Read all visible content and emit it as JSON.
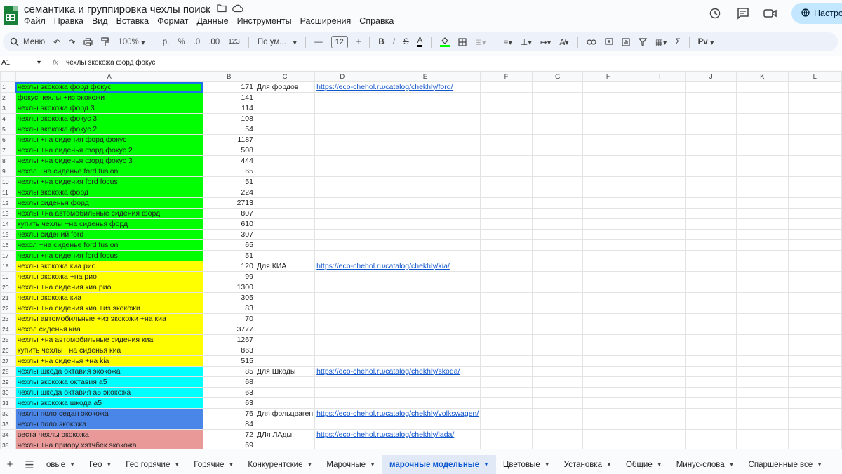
{
  "doc": {
    "title": "семантика и группировка чехлы поиск",
    "menu": [
      "Файл",
      "Правка",
      "Вид",
      "Вставка",
      "Формат",
      "Данные",
      "Инструменты",
      "Расширения",
      "Справка"
    ],
    "share_label": "Настро"
  },
  "toolbar": {
    "search_menu": "Меню",
    "zoom": "100%",
    "currency": "р.",
    "percent": "%",
    "dec_dec": ".0",
    "dec_inc": ".00",
    "number_format": "123",
    "font": "По ум...",
    "font_size": "12",
    "bold": "B",
    "italic": "I",
    "strike": "S",
    "text_color": "A",
    "sum": "Σ",
    "input_tool": "Pv"
  },
  "formula_bar": {
    "cell_ref": "A1",
    "fx": "fx",
    "content": "чехлы экокожа форд фокус"
  },
  "grid": {
    "columns": [
      "A",
      "B",
      "C",
      "D",
      "E",
      "F",
      "G",
      "H",
      "I",
      "J",
      "K",
      "L"
    ],
    "colors": {
      "green": "#00ff00",
      "yellow": "#ffff00",
      "cyan": "#00ffff",
      "blue": "#4a86e8",
      "pink": "#ea9999"
    },
    "rows": [
      {
        "n": "1",
        "a": "чехлы экокожа форд фокус",
        "b": "171",
        "c": "Для фордов",
        "d": "https://eco-chehol.ru/catalog/chekhly/ford/",
        "color": "green"
      },
      {
        "n": "2",
        "a": "фокус чехлы +из экокожи",
        "b": "141",
        "c": "",
        "d": "",
        "color": "green"
      },
      {
        "n": "3",
        "a": "чехлы экокожа форд 3",
        "b": "114",
        "c": "",
        "d": "",
        "color": "green"
      },
      {
        "n": "4",
        "a": "чехлы экокожа фокус 3",
        "b": "108",
        "c": "",
        "d": "",
        "color": "green"
      },
      {
        "n": "5",
        "a": "чехлы экокожа фокус 2",
        "b": "54",
        "c": "",
        "d": "",
        "color": "green"
      },
      {
        "n": "6",
        "a": "чехлы +на сидения форд фокус",
        "b": "1187",
        "c": "",
        "d": "",
        "color": "green"
      },
      {
        "n": "7",
        "a": "чехлы +на сиденья форд фокус 2",
        "b": "508",
        "c": "",
        "d": "",
        "color": "green"
      },
      {
        "n": "8",
        "a": "чехлы +на сиденья форд фокус 3",
        "b": "444",
        "c": "",
        "d": "",
        "color": "green"
      },
      {
        "n": "9",
        "a": "чехол +на сиденье ford fusion",
        "b": "65",
        "c": "",
        "d": "",
        "color": "green"
      },
      {
        "n": "10",
        "a": "чехлы +на сидения ford focus",
        "b": "51",
        "c": "",
        "d": "",
        "color": "green"
      },
      {
        "n": "11",
        "a": "чехлы экокожа форд",
        "b": "224",
        "c": "",
        "d": "",
        "color": "green"
      },
      {
        "n": "12",
        "a": "чехлы сиденья форд",
        "b": "2713",
        "c": "",
        "d": "",
        "color": "green"
      },
      {
        "n": "13",
        "a": "чехлы +на автомобильные сидения форд",
        "b": "807",
        "c": "",
        "d": "",
        "color": "green"
      },
      {
        "n": "14",
        "a": "купить чехлы +на сиденья форд",
        "b": "610",
        "c": "",
        "d": "",
        "color": "green"
      },
      {
        "n": "15",
        "a": "чехлы сидений ford",
        "b": "307",
        "c": "",
        "d": "",
        "color": "green"
      },
      {
        "n": "16",
        "a": "чехол +на сиденье ford fusion",
        "b": "65",
        "c": "",
        "d": "",
        "color": "green"
      },
      {
        "n": "17",
        "a": "чехлы +на сидения ford focus",
        "b": "51",
        "c": "",
        "d": "",
        "color": "green"
      },
      {
        "n": "18",
        "a": "чехлы экокожа киа рио",
        "b": "120",
        "c": "Для КИА",
        "d": "https://eco-chehol.ru/catalog/chekhly/kia/",
        "color": "yellow"
      },
      {
        "n": "19",
        "a": "чехлы экокожа +на рио",
        "b": "99",
        "c": "",
        "d": "",
        "color": "yellow"
      },
      {
        "n": "20",
        "a": "чехлы +на сидения киа рио",
        "b": "1300",
        "c": "",
        "d": "",
        "color": "yellow"
      },
      {
        "n": "21",
        "a": "чехлы экокожа киа",
        "b": "305",
        "c": "",
        "d": "",
        "color": "yellow"
      },
      {
        "n": "22",
        "a": "чехлы +на сидения киа +из экокожи",
        "b": "83",
        "c": "",
        "d": "",
        "color": "yellow"
      },
      {
        "n": "23",
        "a": "чехлы автомобильные +из экокожи +на киа",
        "b": "70",
        "c": "",
        "d": "",
        "color": "yellow"
      },
      {
        "n": "24",
        "a": "чехол сиденья киа",
        "b": "3777",
        "c": "",
        "d": "",
        "color": "yellow"
      },
      {
        "n": "25",
        "a": "чехлы +на автомобильные сидения киа",
        "b": "1267",
        "c": "",
        "d": "",
        "color": "yellow"
      },
      {
        "n": "26",
        "a": "купить чехлы +на сиденья киа",
        "b": "863",
        "c": "",
        "d": "",
        "color": "yellow"
      },
      {
        "n": "27",
        "a": "чехлы +на сиденья +на kia",
        "b": "515",
        "c": "",
        "d": "",
        "color": "yellow"
      },
      {
        "n": "28",
        "a": "чехлы шкода октавия экокожа",
        "b": "85",
        "c": "Для Шкоды",
        "d": "https://eco-chehol.ru/catalog/chekhly/skoda/",
        "color": "cyan"
      },
      {
        "n": "29",
        "a": "чехлы экокожа октавия а5",
        "b": "68",
        "c": "",
        "d": "",
        "color": "cyan"
      },
      {
        "n": "30",
        "a": "чехлы шкода октавия а5 экокожа",
        "b": "63",
        "c": "",
        "d": "",
        "color": "cyan"
      },
      {
        "n": "31",
        "a": "чехлы экокожа шкода а5",
        "b": "63",
        "c": "",
        "d": "",
        "color": "cyan"
      },
      {
        "n": "32",
        "a": "чехлы поло седан экокожа",
        "b": "76",
        "c": "Для фольцваген",
        "d": "https://eco-chehol.ru/catalog/chekhly/volkswagen/",
        "color": "blue"
      },
      {
        "n": "33",
        "a": "чехлы поло экокожа",
        "b": "84",
        "c": "",
        "d": "",
        "color": "blue"
      },
      {
        "n": "34",
        "a": "веста чехлы экокожа",
        "b": "72",
        "c": "ДЛя ЛАды",
        "d": "https://eco-chehol.ru/catalog/chekhly/lada/",
        "color": "pink"
      },
      {
        "n": "35",
        "a": "чехлы +на приору хэтчбек экокожа",
        "b": "69",
        "c": "",
        "d": "",
        "color": "pink"
      }
    ]
  },
  "tabs": [
    {
      "label": "овые",
      "active": false
    },
    {
      "label": "Гео",
      "active": false
    },
    {
      "label": "Гео горячие",
      "active": false
    },
    {
      "label": "Горячие",
      "active": false
    },
    {
      "label": "Конкурентские",
      "active": false
    },
    {
      "label": "Марочные",
      "active": false
    },
    {
      "label": "марочные модельные",
      "active": true
    },
    {
      "label": "Цветовые",
      "active": false
    },
    {
      "label": "Установка",
      "active": false
    },
    {
      "label": "Общие",
      "active": false
    },
    {
      "label": "Минус-слова",
      "active": false
    },
    {
      "label": "Спаршенные все",
      "active": false
    }
  ]
}
